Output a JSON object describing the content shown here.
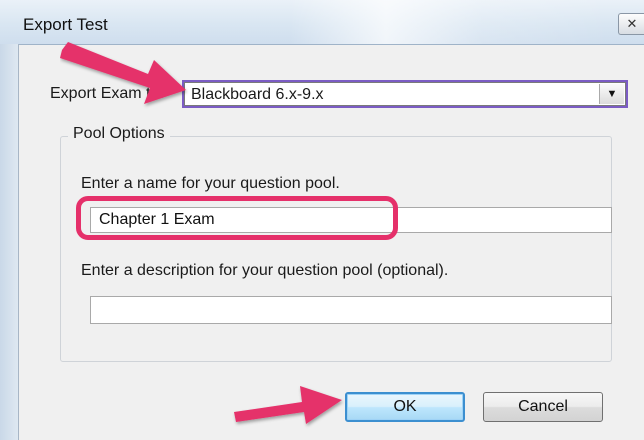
{
  "window": {
    "title": "Export Test",
    "close_label": "✕"
  },
  "export": {
    "label": "Export Exam to:",
    "format_value": "Blackboard 6.x-9.x",
    "dropdown_glyph": "▼"
  },
  "pool_options": {
    "group_title": "Pool Options",
    "name_prompt": "Enter a name for your question pool.",
    "name_value": "Chapter 1 Exam",
    "description_prompt": "Enter a description for your question pool (optional).",
    "description_value": ""
  },
  "buttons": {
    "ok_label": "OK",
    "cancel_label": "Cancel"
  },
  "annotations": {
    "arrow_color": "#e5306a",
    "highlight_color": "#e5306a",
    "focus_outline_color": "#7b5cc4",
    "icons": [
      "arrow-annotation-icon",
      "close-icon",
      "chevron-down-icon"
    ]
  }
}
